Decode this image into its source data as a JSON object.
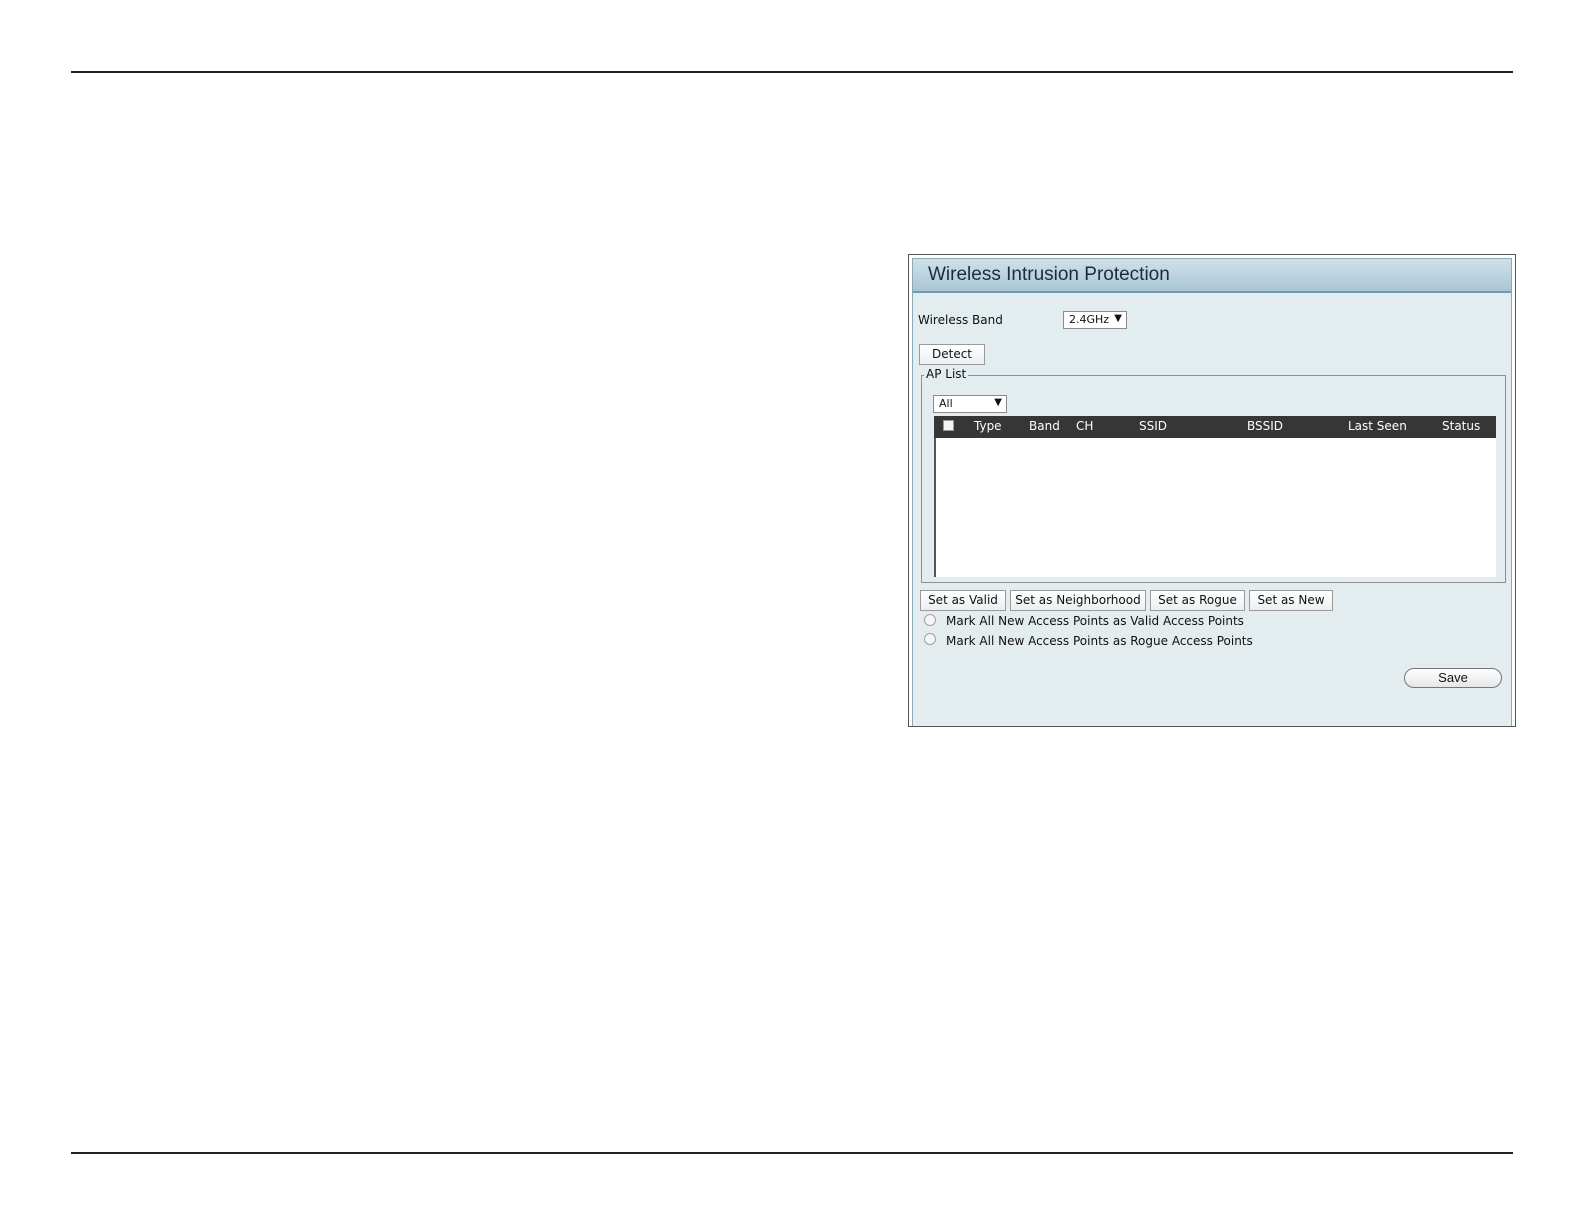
{
  "panel": {
    "title": "Wireless Intrusion Protection",
    "wireless_band": {
      "label": "Wireless Band",
      "value": "2.4GHz",
      "arrow": "▼"
    },
    "detect_label": "Detect",
    "ap_list": {
      "legend": "AP List",
      "filter": {
        "value": "All",
        "arrow": "▼"
      },
      "columns": {
        "type": "Type",
        "band": "Band",
        "ch": "CH",
        "ssid": "SSID",
        "bssid": "BSSID",
        "last_seen": "Last Seen",
        "status": "Status"
      },
      "rows": []
    },
    "actions": {
      "set_valid": "Set as Valid",
      "set_neighborhood": "Set as Neighborhood",
      "set_rogue": "Set as Rogue",
      "set_new": "Set as New"
    },
    "options": {
      "mark_valid": "Mark All New Access Points as Valid Access Points",
      "mark_rogue": "Mark All New Access Points as Rogue Access Points"
    },
    "save_label": "Save"
  }
}
